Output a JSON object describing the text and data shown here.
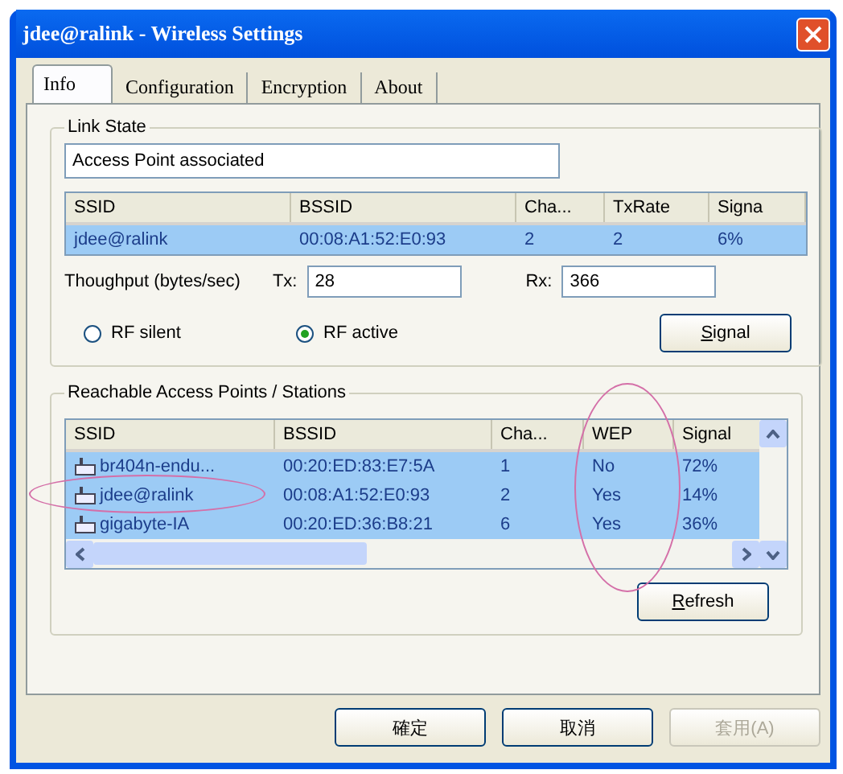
{
  "window": {
    "title": "jdee@ralink - Wireless Settings"
  },
  "tabs": [
    {
      "label": "Info",
      "selected": true
    },
    {
      "label": "Configuration",
      "selected": false
    },
    {
      "label": "Encryption",
      "selected": false
    },
    {
      "label": "About",
      "selected": false
    }
  ],
  "link_state": {
    "title": "Link State",
    "status": "Access Point associated",
    "columns": [
      {
        "label": "SSID"
      },
      {
        "label": "BSSID"
      },
      {
        "label": "Cha..."
      },
      {
        "label": "TxRate"
      },
      {
        "label": "Signa"
      }
    ],
    "rows": [
      {
        "selected": true,
        "cells": [
          "jdee@ralink",
          "00:08:A1:52:E0:93",
          "2",
          "2",
          "6%"
        ]
      }
    ],
    "throughput_label": "Thoughput (bytes/sec)",
    "tx_label": "Tx:",
    "tx_value": "28",
    "rx_label": "Rx:",
    "rx_value": "366",
    "radios": [
      {
        "label": "RF silent",
        "selected": false
      },
      {
        "label": "RF active",
        "selected": true
      }
    ],
    "signal_button": "Signal"
  },
  "reachable": {
    "title": "Reachable Access Points / Stations",
    "columns": [
      {
        "label": "SSID",
        "circled": false
      },
      {
        "label": "BSSID",
        "circled": false
      },
      {
        "label": "Cha...",
        "circled": false
      },
      {
        "label": "WEP",
        "circled": true
      },
      {
        "label": "Signal",
        "circled": false
      }
    ],
    "rows": [
      {
        "selected": true,
        "circled": false,
        "cells": [
          "br404n-endu...",
          "00:20:ED:83:E7:5A",
          "1",
          "No",
          "72%"
        ]
      },
      {
        "selected": true,
        "circled": true,
        "cells": [
          "jdee@ralink",
          "00:08:A1:52:E0:93",
          "2",
          "Yes",
          "14%"
        ]
      },
      {
        "selected": true,
        "circled": false,
        "cells": [
          "gigabyte-IA",
          "00:20:ED:36:B8:21",
          "6",
          "Yes",
          "36%"
        ]
      }
    ],
    "refresh_button": "Refresh"
  },
  "buttons": [
    {
      "label": "確定",
      "disabled": false
    },
    {
      "label": "取消",
      "disabled": false
    },
    {
      "label": "套用(A)",
      "disabled": true
    }
  ]
}
